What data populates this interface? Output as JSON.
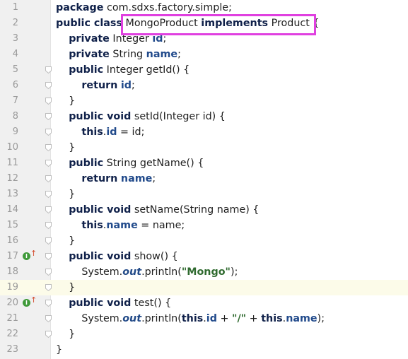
{
  "editor": {
    "current_line": 19,
    "highlight_color": "#e040e0",
    "lines": [
      {
        "n": "1",
        "tokens": [
          {
            "t": "package",
            "c": "kw"
          },
          {
            "t": " com.sdxs.factory.simple;",
            "c": ""
          }
        ]
      },
      {
        "n": "2",
        "tokens": [
          {
            "t": "public class",
            "c": "kw"
          },
          {
            "t": " MongoProduct ",
            "c": ""
          },
          {
            "t": "implements",
            "c": "kw"
          },
          {
            "t": " Product {",
            "c": ""
          }
        ]
      },
      {
        "n": "3",
        "tokens": [
          {
            "t": "    ",
            "c": ""
          },
          {
            "t": "private",
            "c": "kw"
          },
          {
            "t": " Integer ",
            "c": ""
          },
          {
            "t": "id",
            "c": "fld"
          },
          {
            "t": ";",
            "c": ""
          }
        ]
      },
      {
        "n": "4",
        "tokens": [
          {
            "t": "    ",
            "c": ""
          },
          {
            "t": "private",
            "c": "kw"
          },
          {
            "t": " String ",
            "c": ""
          },
          {
            "t": "name",
            "c": "fld"
          },
          {
            "t": ";",
            "c": ""
          }
        ]
      },
      {
        "n": "5",
        "tokens": [
          {
            "t": "    ",
            "c": ""
          },
          {
            "t": "public",
            "c": "kw"
          },
          {
            "t": " Integer getId() {",
            "c": ""
          }
        ]
      },
      {
        "n": "6",
        "tokens": [
          {
            "t": "        ",
            "c": ""
          },
          {
            "t": "return",
            "c": "kw"
          },
          {
            "t": " ",
            "c": ""
          },
          {
            "t": "id",
            "c": "fld"
          },
          {
            "t": ";",
            "c": ""
          }
        ]
      },
      {
        "n": "7",
        "tokens": [
          {
            "t": "    }",
            "c": ""
          }
        ]
      },
      {
        "n": "8",
        "tokens": [
          {
            "t": "    ",
            "c": ""
          },
          {
            "t": "public void",
            "c": "kw"
          },
          {
            "t": " setId(Integer id) {",
            "c": ""
          }
        ]
      },
      {
        "n": "9",
        "tokens": [
          {
            "t": "        ",
            "c": ""
          },
          {
            "t": "this",
            "c": "kw"
          },
          {
            "t": ".",
            "c": ""
          },
          {
            "t": "id",
            "c": "fld"
          },
          {
            "t": " = id;",
            "c": ""
          }
        ]
      },
      {
        "n": "10",
        "tokens": [
          {
            "t": "    }",
            "c": ""
          }
        ]
      },
      {
        "n": "11",
        "tokens": [
          {
            "t": "    ",
            "c": ""
          },
          {
            "t": "public",
            "c": "kw"
          },
          {
            "t": " String getName() {",
            "c": ""
          }
        ]
      },
      {
        "n": "12",
        "tokens": [
          {
            "t": "        ",
            "c": ""
          },
          {
            "t": "return",
            "c": "kw"
          },
          {
            "t": " ",
            "c": ""
          },
          {
            "t": "name",
            "c": "fld"
          },
          {
            "t": ";",
            "c": ""
          }
        ]
      },
      {
        "n": "13",
        "tokens": [
          {
            "t": "    }",
            "c": ""
          }
        ]
      },
      {
        "n": "14",
        "tokens": [
          {
            "t": "    ",
            "c": ""
          },
          {
            "t": "public void",
            "c": "kw"
          },
          {
            "t": " setName(String name) {",
            "c": ""
          }
        ]
      },
      {
        "n": "15",
        "tokens": [
          {
            "t": "        ",
            "c": ""
          },
          {
            "t": "this",
            "c": "kw"
          },
          {
            "t": ".",
            "c": ""
          },
          {
            "t": "name",
            "c": "fld"
          },
          {
            "t": " = name;",
            "c": ""
          }
        ]
      },
      {
        "n": "16",
        "tokens": [
          {
            "t": "    }",
            "c": ""
          }
        ]
      },
      {
        "n": "17",
        "tokens": [
          {
            "t": "    ",
            "c": ""
          },
          {
            "t": "public void",
            "c": "kw"
          },
          {
            "t": " show() {",
            "c": ""
          }
        ]
      },
      {
        "n": "18",
        "tokens": [
          {
            "t": "        System.",
            "c": ""
          },
          {
            "t": "out",
            "c": "static"
          },
          {
            "t": ".println(",
            "c": ""
          },
          {
            "t": "\"Mongo\"",
            "c": "str"
          },
          {
            "t": ");",
            "c": ""
          }
        ]
      },
      {
        "n": "19",
        "tokens": [
          {
            "t": "    }",
            "c": ""
          }
        ]
      },
      {
        "n": "20",
        "tokens": [
          {
            "t": "    ",
            "c": ""
          },
          {
            "t": "public void",
            "c": "kw"
          },
          {
            "t": " test() {",
            "c": ""
          }
        ]
      },
      {
        "n": "21",
        "tokens": [
          {
            "t": "        System.",
            "c": ""
          },
          {
            "t": "out",
            "c": "static"
          },
          {
            "t": ".println(",
            "c": ""
          },
          {
            "t": "this",
            "c": "kw"
          },
          {
            "t": ".",
            "c": ""
          },
          {
            "t": "id",
            "c": "fld"
          },
          {
            "t": " + ",
            "c": ""
          },
          {
            "t": "\"/\"",
            "c": "str"
          },
          {
            "t": " + ",
            "c": ""
          },
          {
            "t": "this",
            "c": "kw"
          },
          {
            "t": ".",
            "c": ""
          },
          {
            "t": "name",
            "c": "fld"
          },
          {
            "t": ");",
            "c": ""
          }
        ]
      },
      {
        "n": "22",
        "tokens": [
          {
            "t": "    }",
            "c": ""
          }
        ]
      },
      {
        "n": "23",
        "tokens": [
          {
            "t": "}",
            "c": ""
          }
        ]
      }
    ],
    "implement_markers": [
      "17",
      "20"
    ],
    "fold_lines": [
      "5",
      "6",
      "7",
      "8",
      "9",
      "10",
      "11",
      "12",
      "13",
      "14",
      "15",
      "16",
      "17",
      "18",
      "19",
      "20",
      "21",
      "22"
    ]
  }
}
